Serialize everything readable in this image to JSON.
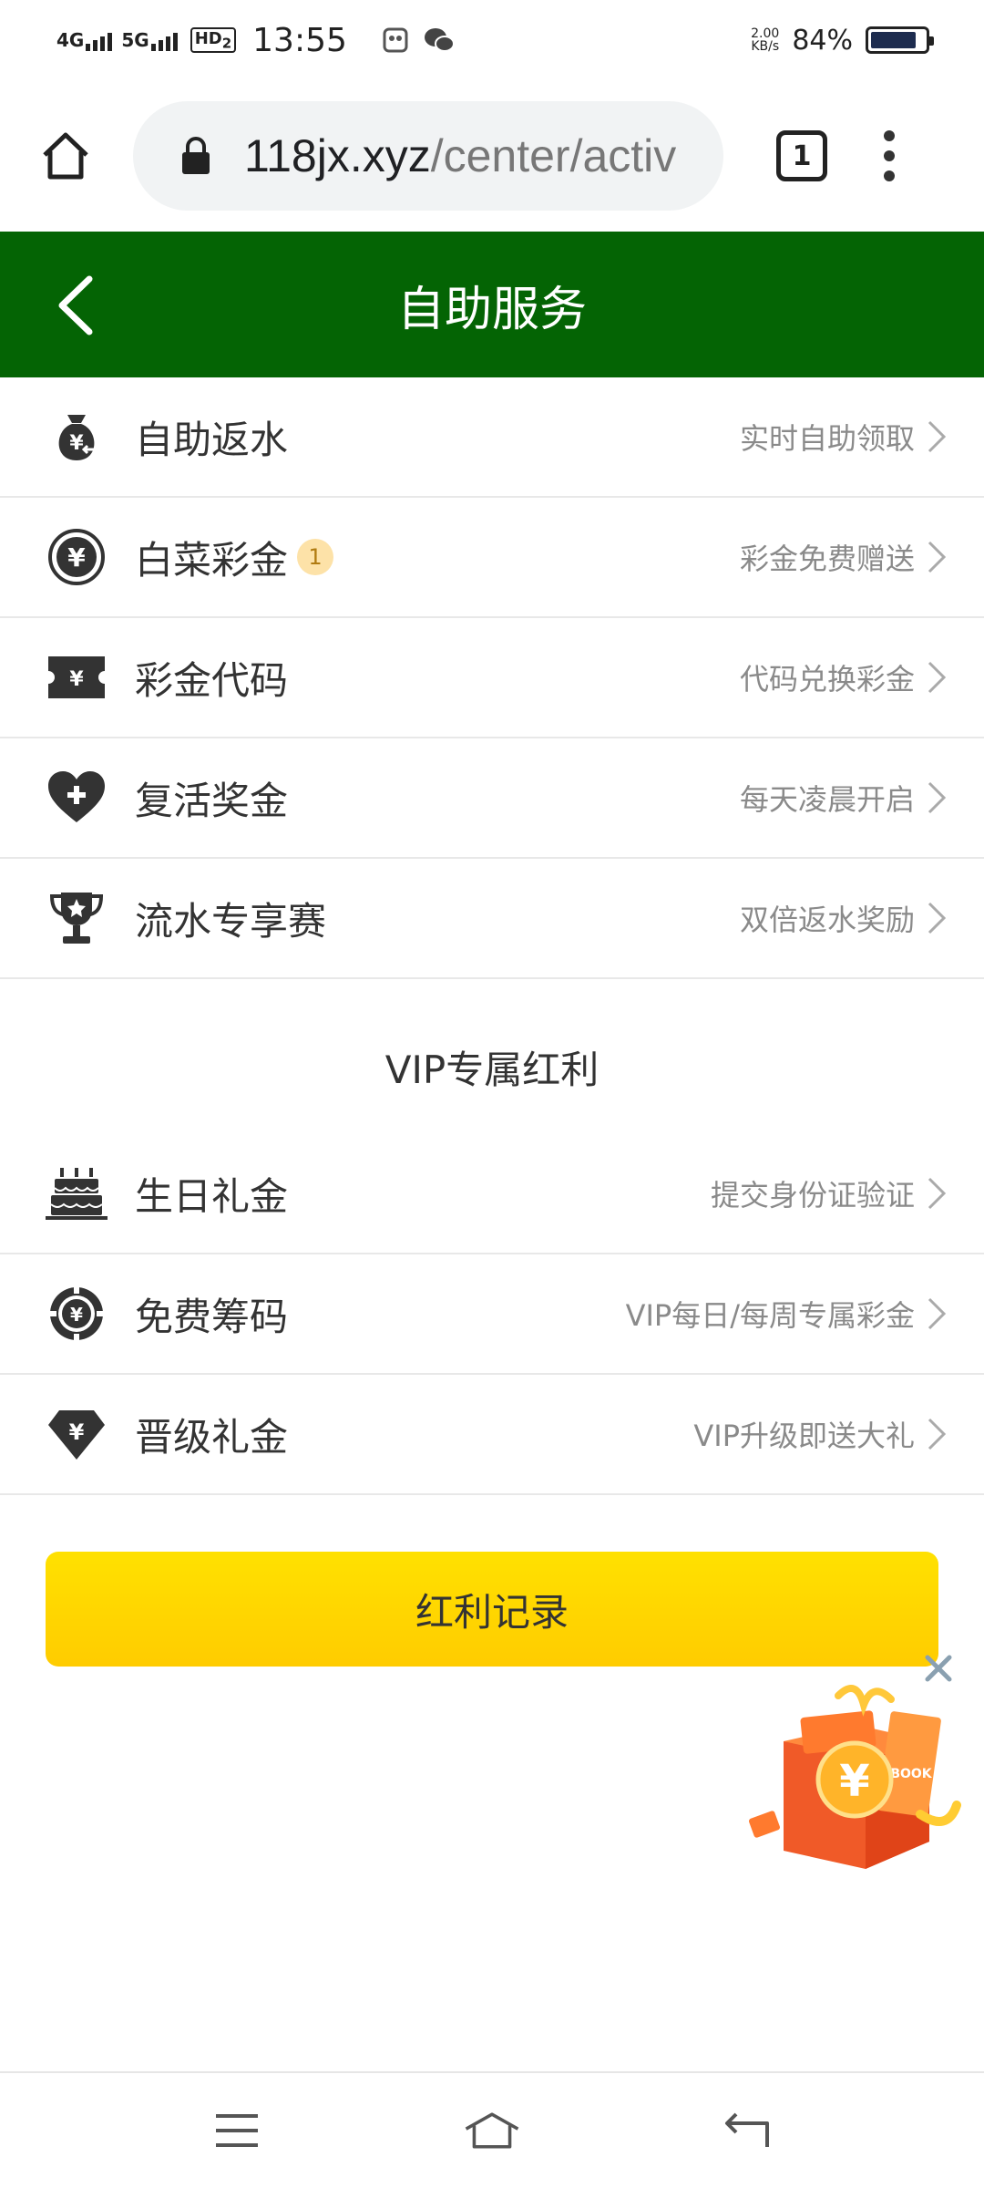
{
  "status_bar": {
    "net1": "4G",
    "net2": "5G",
    "hd": "HD",
    "hd_sub": "2",
    "time": "13:55",
    "speed_value": "2.00",
    "speed_unit": "KB/s",
    "battery": "84%",
    "battery_level": 0.84
  },
  "browser": {
    "url_host": "118jx.xyz",
    "url_path": "/center/activ",
    "tab_count": "1"
  },
  "header": {
    "title": "自助服务"
  },
  "services": [
    {
      "label": "自助返水",
      "hint": "实时自助领取",
      "icon": "money-bag-icon"
    },
    {
      "label": "白菜彩金",
      "hint": "彩金免费赠送",
      "icon": "yen-circle-icon",
      "badge": "1"
    },
    {
      "label": "彩金代码",
      "hint": "代码兑换彩金",
      "icon": "ticket-yen-icon"
    },
    {
      "label": "复活奖金",
      "hint": "每天凌晨开启",
      "icon": "heart-plus-icon"
    },
    {
      "label": "流水专享赛",
      "hint": "双倍返水奖励",
      "icon": "trophy-icon"
    }
  ],
  "vip": {
    "section_title": "VIP专属红利",
    "items": [
      {
        "label": "生日礼金",
        "hint": "提交身份证验证",
        "icon": "cake-icon"
      },
      {
        "label": "免费筹码",
        "hint": "VIP每日/每周专属彩金",
        "icon": "chip-yen-icon"
      },
      {
        "label": "晋级礼金",
        "hint": "VIP升级即送大礼",
        "icon": "diamond-yen-icon"
      }
    ]
  },
  "record_button": "红利记录",
  "gift": {
    "book_label": "BOOK",
    "yen": "¥"
  }
}
